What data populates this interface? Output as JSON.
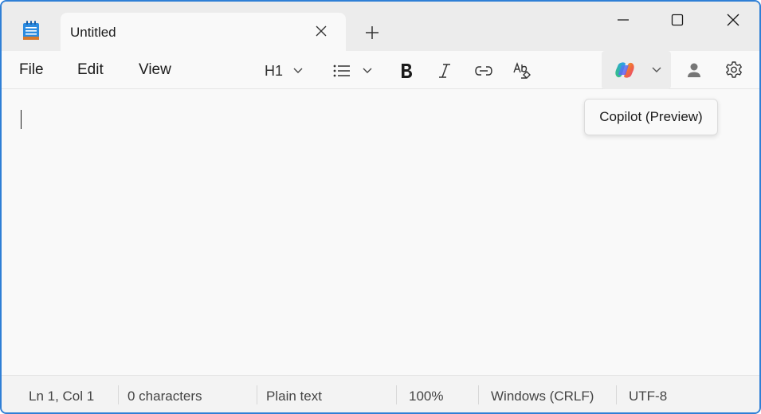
{
  "tab": {
    "title": "Untitled"
  },
  "menu": {
    "file": "File",
    "edit": "Edit",
    "view": "View"
  },
  "toolbar": {
    "heading_value": "H1",
    "icons": [
      "list-icon",
      "bold-icon",
      "italic-icon",
      "link-icon",
      "clear-formatting-icon",
      "copilot-icon",
      "profile-icon",
      "settings-icon"
    ]
  },
  "tooltip": {
    "text": "Copilot (Preview)"
  },
  "status": {
    "position": "Ln 1, Col 1",
    "characters": "0 characters",
    "format": "Plain text",
    "zoom": "100%",
    "line_endings": "Windows (CRLF)",
    "encoding": "UTF-8"
  },
  "colors": {
    "accent": "#2f7fd6",
    "titlebar": "#ececec",
    "editor": "#f9f9f9"
  }
}
